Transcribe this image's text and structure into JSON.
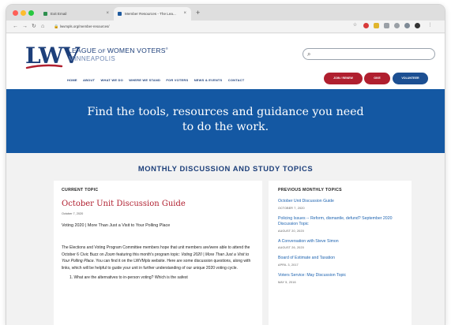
{
  "browser": {
    "tabs": [
      {
        "label": "Exit Email",
        "active": false
      },
      {
        "label": "Member Resources - The Lea...",
        "active": true
      }
    ],
    "tab_close_glyph": "×",
    "newtab_glyph": "+",
    "url": "lwvmpls.org/member-resources/",
    "nav": {
      "back": "←",
      "forward": "→",
      "reload": "↻",
      "home": "⌂"
    },
    "toolbar_icons": [
      "star-icon",
      "extension-icon",
      "extension-icon",
      "extension-icon",
      "extension-icon",
      "puzzle-icon",
      "profile-icon",
      "menu-icon"
    ]
  },
  "site": {
    "logo_mark": "LWV",
    "logo_name_a": "LEAGUE",
    "logo_name_b": " OF ",
    "logo_name_c": "WOMEN VOTERS",
    "logo_name_reg": "®",
    "logo_sub": "MINNEAPOLIS",
    "search_glyph": "⌕",
    "nav": [
      "HOME",
      "ABOUT",
      "WHAT WE DO",
      "WHERE WE STAND",
      "FOR VOTERS",
      "NEWS & EVENTS",
      "CONTACT"
    ],
    "buttons": {
      "join": "JOIN / RENEW",
      "give": "GIVE",
      "volunteer": "VOLUNTEER"
    }
  },
  "hero": {
    "title": "Find the tools, resources and guidance you need to do the work."
  },
  "section_title": "MONTHLY DISCUSSION AND STUDY TOPICS",
  "current": {
    "label": "CURRENT TOPIC",
    "title": "October Unit Discussion Guide",
    "date": "October 7, 2020",
    "subtitle": "Voting 2020 | More Than Just a Visit to Your Polling Place",
    "body_a": "The Elections and Voting Program Committee members hope that unit members are/were able to attend the October 6 Civic Buzz on ",
    "body_zoom": "Zoom",
    "body_b": " featuring this month's program topic: ",
    "body_topic": "Voting 2020 | More Than Just a Visit to Your Polling Place.",
    "body_c": " You can find it on the LWVMpls website. Here are some discussion questions, along with links, which will be helpful to guide your unit in further understanding of our unique 2020 voting cycle.",
    "list_first": "1.  What are the alternatives to in-person voting? Which is the safest"
  },
  "previous": {
    "label": "PREVIOUS MONTHLY TOPICS",
    "items": [
      {
        "title": "October Unit Discussion Guide",
        "date": "OCTOBER 7, 2020"
      },
      {
        "title": "Policing Issues -- Reform, dismantle, defund? September 2020 Discussion Topic",
        "date": "AUGUST 20, 2020"
      },
      {
        "title": "A Conversation with Steve Simon",
        "date": "AUGUST 26, 2020"
      },
      {
        "title": "Board of Estimate and Taxation",
        "date": "APRIL 3, 2017"
      },
      {
        "title": "Voters Service: May Discussion Topic",
        "date": "MAY 5, 2016"
      }
    ]
  },
  "colors": {
    "brand_blue": "#1d3f7a",
    "hero_blue": "#1458a3",
    "brand_red": "#b01f2f",
    "link_blue": "#1d63b0"
  }
}
